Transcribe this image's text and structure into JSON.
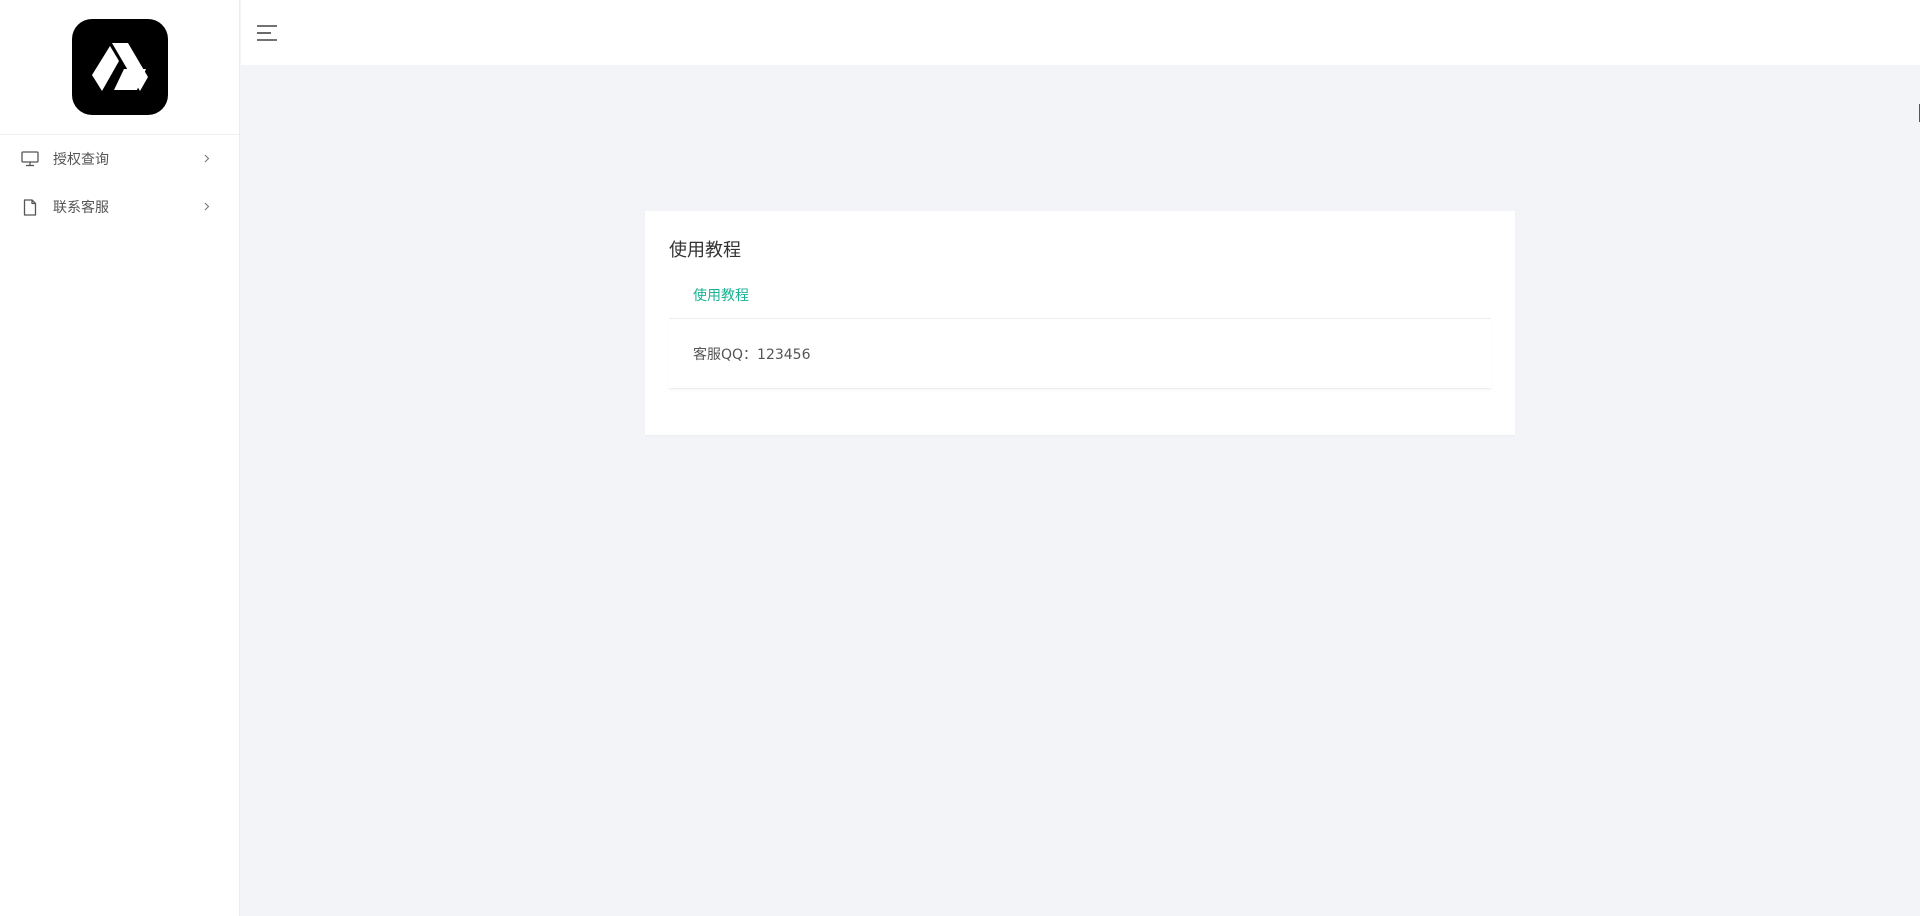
{
  "sidebar": {
    "logo": {
      "icon": "drive-logo-icon",
      "background": "#000000"
    },
    "items": [
      {
        "label": "授权查询",
        "icon": "monitor-icon"
      },
      {
        "label": "联系客服",
        "icon": "file-icon"
      }
    ]
  },
  "header": {
    "menu_icon": "hamburger-menu-icon"
  },
  "card": {
    "title": "使用教程",
    "tab_label": "使用教程",
    "content": "客服QQ：123456"
  },
  "colors": {
    "accent": "#1ab394",
    "page_background": "#f3f4f8",
    "surface": "#ffffff"
  }
}
